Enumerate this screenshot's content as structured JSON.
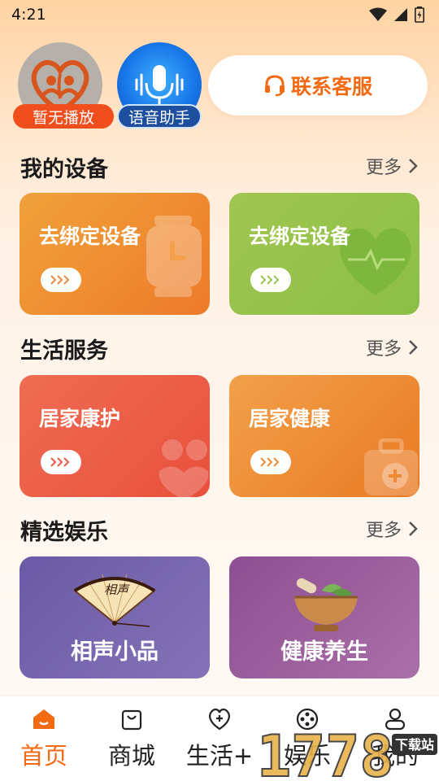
{
  "status_bar": {
    "time": "4:21"
  },
  "header": {
    "player_tag": "暂无播放",
    "voice_tag": "语音助手",
    "service_label": "联系客服"
  },
  "devices": {
    "title": "我的设备",
    "more": "更多",
    "cards": [
      {
        "label": "去绑定设备",
        "icon": "watch-icon"
      },
      {
        "label": "去绑定设备",
        "icon": "heart-monitor-icon"
      }
    ]
  },
  "life": {
    "title": "生活服务",
    "more": "更多",
    "cards": [
      {
        "label": "居家康护",
        "icon": "care-icon"
      },
      {
        "label": "居家健康",
        "icon": "medical-kit-icon"
      }
    ]
  },
  "entertainment": {
    "title": "精选娱乐",
    "more": "更多",
    "cards": [
      {
        "label": "相声小品",
        "fan_text": "相声",
        "icon": "fan-icon"
      },
      {
        "label": "健康养生",
        "icon": "mortar-herbs-icon"
      }
    ]
  },
  "nav": {
    "items": [
      {
        "label": "首页",
        "icon": "home-icon",
        "active": true
      },
      {
        "label": "商城",
        "icon": "shopping-bag-icon",
        "active": false
      },
      {
        "label": "生活+",
        "icon": "heart-plus-icon",
        "active": false
      },
      {
        "label": "娱乐",
        "icon": "film-reel-icon",
        "active": false
      },
      {
        "label": "我的",
        "icon": "user-icon",
        "active": false
      }
    ]
  },
  "watermark": {
    "number": "1778",
    "site": "下载站"
  },
  "colors": {
    "accent": "#f26a12",
    "orange_card": "#ee8a2e",
    "green_card": "#8fc24a",
    "red_card": "#ec5a42",
    "amber_card": "#ed8a30",
    "purple_card_1": "#6e5ca6",
    "purple_card_2": "#9a5a9c"
  }
}
